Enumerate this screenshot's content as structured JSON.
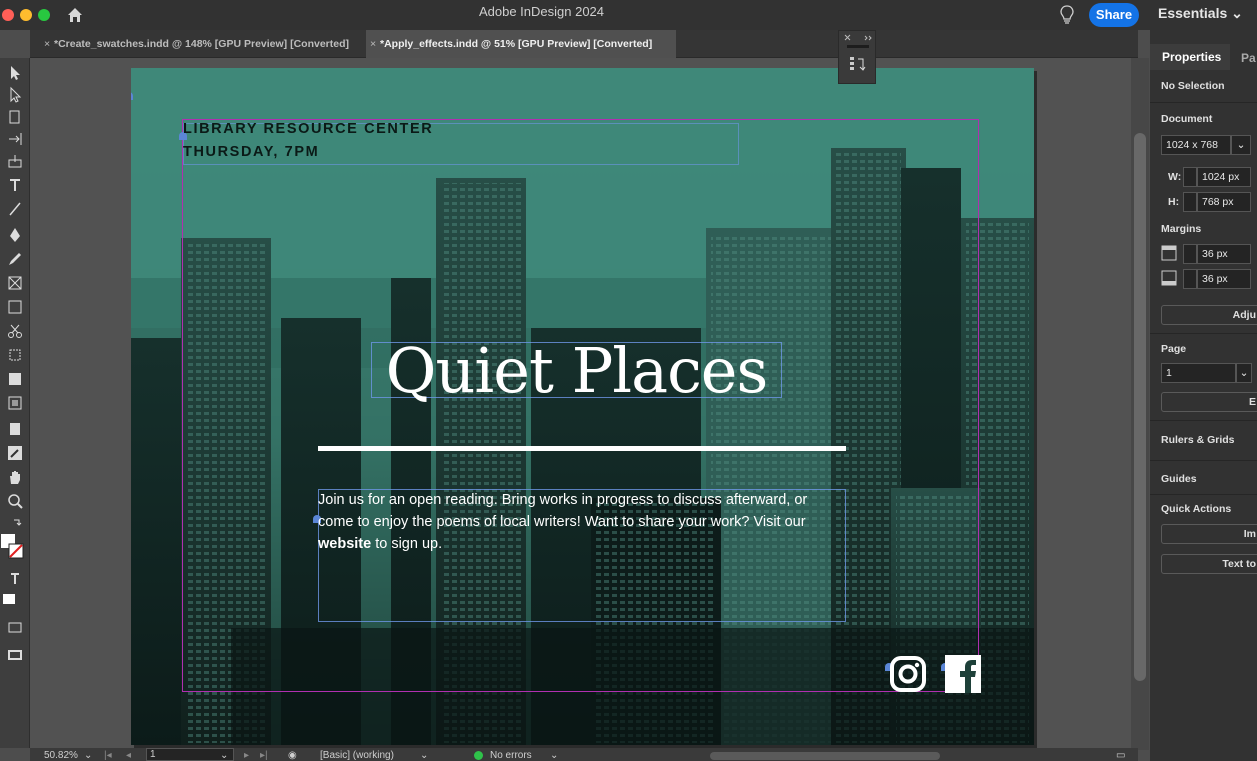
{
  "titlebar": {
    "app_title": "Adobe InDesign 2024",
    "share_label": "Share",
    "workspace_label": "Essentials ⌄"
  },
  "tabs": [
    {
      "label": "*Create_swatches.indd @ 148% [GPU Preview] [Converted]",
      "active": false
    },
    {
      "label": "*Apply_effects.indd @ 51% [GPU Preview] [Converted]",
      "active": true
    }
  ],
  "tab_close": "×",
  "document": {
    "event_line1": "LIBRARY RESOURCE CENTER",
    "event_line2": "THURSDAY, 7PM",
    "headline": "Quiet Places",
    "body_part1": "Join us for an open reading. Bring works in progress to discuss afterward, or come to enjoy the poems of local writers! Want to share your work? Visit our ",
    "body_link": "website",
    "body_part2": " to sign up.",
    "page_color": "#3d8576"
  },
  "statusbar": {
    "zoom": "50.82%",
    "page": "1",
    "preflight_profile": "[Basic] (working)",
    "errors": "No errors"
  },
  "properties": {
    "tab_properties": "Properties",
    "tab_pages": "Pa",
    "selection": "No Selection",
    "document_label": "Document",
    "doc_size": "1024 x 768",
    "w_label": "W:",
    "w_value": "1024 px",
    "h_label": "H:",
    "h_value": "768 px",
    "margins_label": "Margins",
    "margin_top": "36 px",
    "margin_bottom": "36 px",
    "adjust_label": "Adju",
    "page_label": "Page",
    "page_value": "1",
    "edit_label": "E",
    "rulers_label": "Rulers & Grids",
    "guides_label": "Guides",
    "quick_actions_label": "Quick Actions",
    "import_label": "Im",
    "text_to_label": "Text to"
  },
  "colors": {
    "accent": "#1473e6",
    "margin_guide": "#b02fb0",
    "frame_edge": "#6e96e6"
  }
}
